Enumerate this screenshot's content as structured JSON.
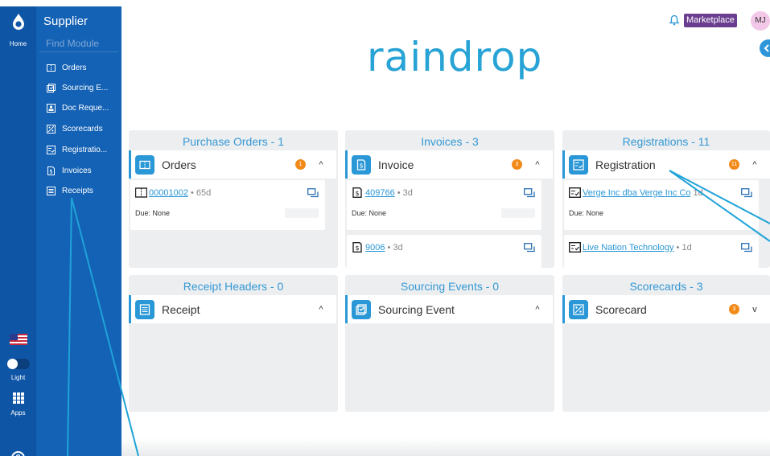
{
  "rail": {
    "home_label": "Home",
    "light_label": "Light",
    "apps_label": "Apps",
    "help_glyph": "?"
  },
  "sidebar": {
    "title": "Supplier",
    "find_placeholder": "Find Module",
    "items": [
      {
        "label": "Orders",
        "icon": "orders-icon"
      },
      {
        "label": "Sourcing E...",
        "icon": "sourcing-icon"
      },
      {
        "label": "Doc Reque...",
        "icon": "doc-request-icon"
      },
      {
        "label": "Scorecards",
        "icon": "scorecard-icon"
      },
      {
        "label": "Registratio...",
        "icon": "registration-icon"
      },
      {
        "label": "Invoices",
        "icon": "invoice-icon"
      },
      {
        "label": "Receipts",
        "icon": "receipt-icon"
      }
    ]
  },
  "header": {
    "marketplace_label": "Marketplace",
    "avatar_initials": "MJ",
    "logo_text": "raindrop"
  },
  "panels": {
    "purchase_orders": {
      "title": "Purchase Orders - 1",
      "module": "Orders",
      "badge": "1",
      "chevron": "^",
      "rows": [
        {
          "number": "00001002",
          "age": "• 65d",
          "due": "Due: None"
        }
      ]
    },
    "invoices": {
      "title": "Invoices - 3",
      "module": "Invoice",
      "badge": "3",
      "chevron": "^",
      "rows": [
        {
          "number": "409766",
          "age": "• 3d",
          "due": "Due: None"
        },
        {
          "number": "9006",
          "age": "• 3d"
        }
      ]
    },
    "registrations": {
      "title": "Registrations - 11",
      "module": "Registration",
      "badge": "11",
      "chevron": "^",
      "rows": [
        {
          "number": "Verge Inc dba Verge Inc Co",
          "age": "1d",
          "due": "Due: None"
        },
        {
          "number": "Live Nation Technology",
          "age": "• 1d"
        }
      ]
    },
    "receipt_headers": {
      "title": "Receipt Headers - 0",
      "module": "Receipt",
      "chevron": "^"
    },
    "sourcing_events": {
      "title": "Sourcing Events - 0",
      "module": "Sourcing Event",
      "chevron": "^"
    },
    "scorecards": {
      "title": "Scorecards - 3",
      "module": "Scorecard",
      "badge": "3",
      "chevron": "v"
    }
  },
  "colors": {
    "rail": "#0e55a5",
    "sidebar": "#1462b5",
    "accent": "#2a97d6",
    "badge": "#f28a19",
    "marketplace": "#6a3d8f",
    "annotation": "#1fa3d8"
  }
}
